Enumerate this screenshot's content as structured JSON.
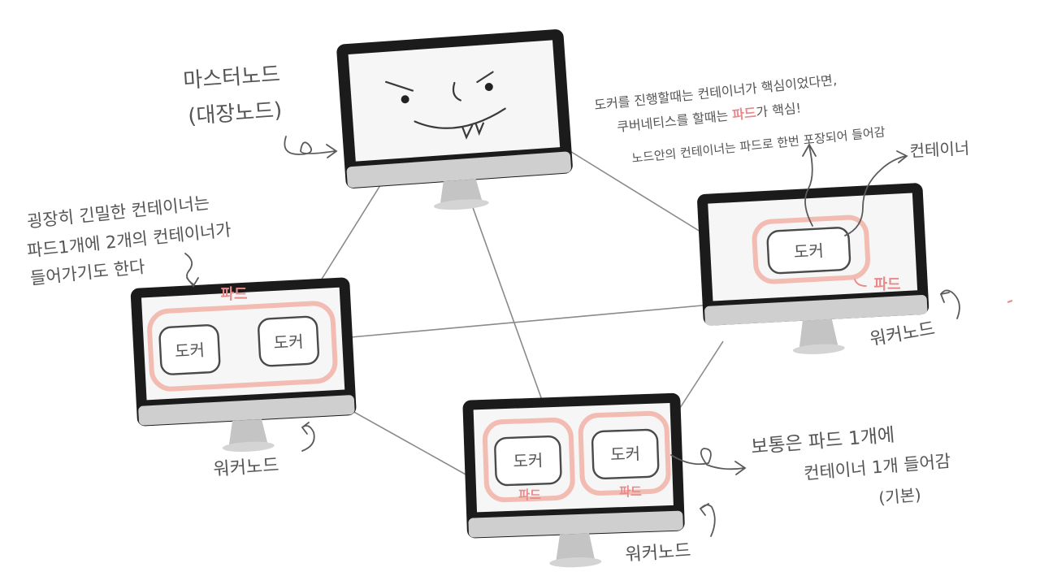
{
  "master": {
    "title_line1": "마스터노드",
    "title_line2": "(대장노드)"
  },
  "workers": {
    "label": "워커노드"
  },
  "containers": {
    "docker": "도커",
    "pod": "파드",
    "container_label": "컨테이너"
  },
  "notes": {
    "tight_pod": [
      "굉장히 긴밀한 컨테이너는",
      "파드1개에 2개의 컨테이너가",
      "들어가기도 한다"
    ],
    "k8s": {
      "line1": "도커를 진행할때는 컨테이너가 핵심이었다면,",
      "line2_prefix": "쿠버네티스를 할때는 ",
      "line2_pink": "파드",
      "line2_suffix": "가 핵심!",
      "line3": "노드안의 컨테이너는 파드로 한번 포장되어 들어감"
    },
    "default_pod": [
      "보통은 파드 1개에",
      "컨테이너 1개 들어감",
      "(기본)"
    ]
  }
}
